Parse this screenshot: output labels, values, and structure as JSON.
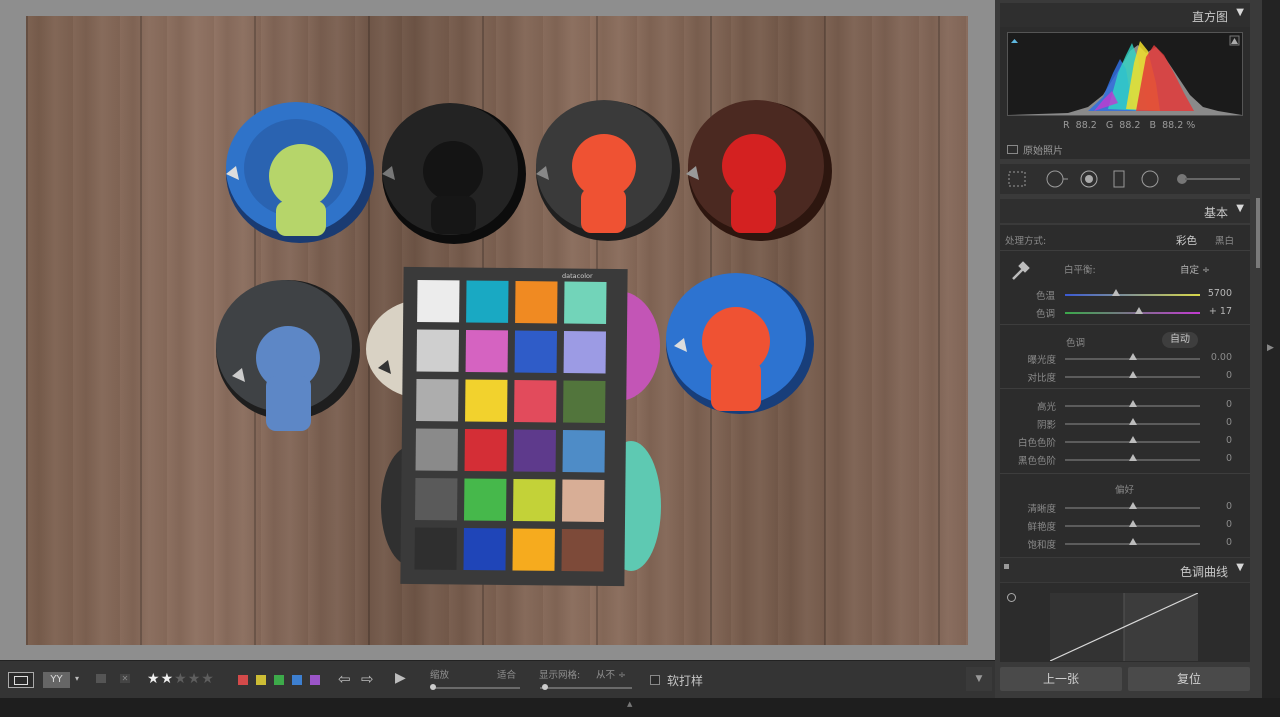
{
  "histogram": {
    "title": "直方图",
    "readout": {
      "r_label": "R",
      "r": "88.2",
      "g_label": "G",
      "g": "88.2",
      "b_label": "B",
      "b": "88.2",
      "unit": "%"
    },
    "original_photo_label": "原始照片"
  },
  "basic": {
    "title": "基本",
    "treatment_label": "处理方式:",
    "color_option": "彩色",
    "bw_option": "黑白",
    "wb_label": "白平衡:",
    "wb_value": "自定 ÷",
    "temp": {
      "label": "色温",
      "value": "5700",
      "level": 0.38
    },
    "tint": {
      "label": "色调",
      "value": "+ 17",
      "level": 0.55
    },
    "tone_label": "色调",
    "auto_button": "自动",
    "tone_sliders": [
      {
        "label": "曝光度",
        "value": "0.00",
        "level": 0.5
      },
      {
        "label": "对比度",
        "value": "0",
        "level": 0.5
      }
    ],
    "light_sliders": [
      {
        "label": "高光",
        "value": "0",
        "level": 0.5
      },
      {
        "label": "阴影",
        "value": "0",
        "level": 0.5
      },
      {
        "label": "白色色阶",
        "value": "0",
        "level": 0.5
      },
      {
        "label": "黑色色阶",
        "value": "0",
        "level": 0.5
      }
    ],
    "presence_label": "偏好",
    "presence_sliders": [
      {
        "label": "清晰度",
        "value": "0",
        "level": 0.5
      },
      {
        "label": "鲜艳度",
        "value": "0",
        "level": 0.5
      },
      {
        "label": "饱和度",
        "value": "0",
        "level": 0.5
      }
    ]
  },
  "tone_curve": {
    "title": "色调曲线"
  },
  "panel_buttons": {
    "previous": "上一张",
    "reset": "复位"
  },
  "toolbar": {
    "compare_label": "YY",
    "rating_stars": 2,
    "rating_max": 5,
    "star_char": "★",
    "color_labels": [
      "#d44a4a",
      "#cdbd35",
      "#3daa4a",
      "#3d7fd0",
      "#9b55c8"
    ],
    "zoom_label": "缩放",
    "fit_label": "适合",
    "grid_label": "显示网格:",
    "grid_value": "从不 ÷",
    "soft_proof_label": "软打样"
  },
  "colorchecker": {
    "brand": "datacolor",
    "patches": [
      [
        "#ececec",
        "#19a9c3",
        "#f08a22",
        "#72d4b9"
      ],
      [
        "#cfcfcf",
        "#d563c1",
        "#2f5cc8",
        "#9c9be4"
      ],
      [
        "#adadad",
        "#f2d22d",
        "#e24b5c",
        "#52753c"
      ],
      [
        "#8a8a8a",
        "#d42e36",
        "#5e3a8c",
        "#4e8cc7"
      ],
      [
        "#5a5a5a",
        "#46b84b",
        "#c3d238",
        "#d8ae96"
      ],
      [
        "#2f2f2f",
        "#1f45b8",
        "#f6ab1e",
        "#7d4a39"
      ]
    ]
  }
}
